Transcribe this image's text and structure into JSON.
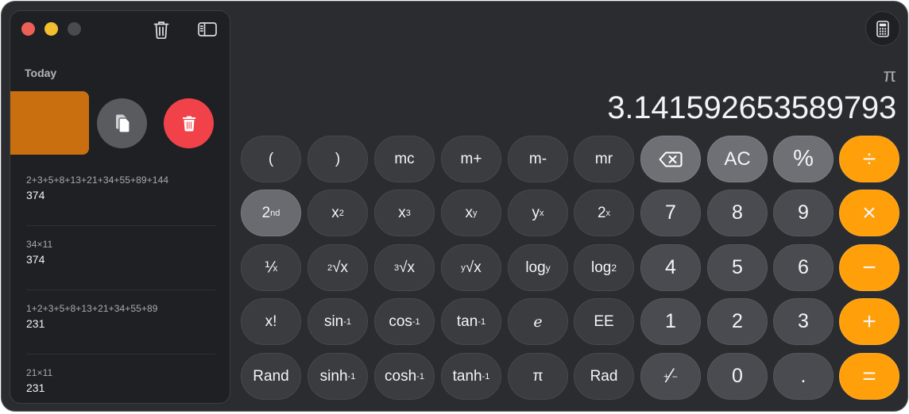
{
  "sidebar": {
    "section_title": "Today",
    "history": [
      {
        "expression": "2+3+5+8+13+21+34+55+89+144",
        "result": "374"
      },
      {
        "expression": "34×11",
        "result": "374"
      },
      {
        "expression": "1+2+3+5+8+13+21+34+55+89",
        "result": "231"
      },
      {
        "expression": "21×11",
        "result": "231"
      }
    ],
    "icons": [
      "trash-icon",
      "sidebar-toggle-icon",
      "copy-icon",
      "delete-icon"
    ]
  },
  "display": {
    "expression": "π",
    "value": "3.141592653589793"
  },
  "keys": {
    "r1": [
      "(",
      ")",
      "mc",
      "m+",
      "m-",
      "mr"
    ],
    "backspace_icon": "backspace-icon",
    "ac": "AC",
    "percent": "%",
    "divide": "÷",
    "second": {
      "base": "2",
      "sup": "nd"
    },
    "x2": {
      "base": "x",
      "sup": "2"
    },
    "x3": {
      "base": "x",
      "sup": "3"
    },
    "xy": {
      "base": "x",
      "sup": "y"
    },
    "yx": {
      "base": "y",
      "sup": "x"
    },
    "twox": {
      "base": "2",
      "sup": "x"
    },
    "d7": "7",
    "d8": "8",
    "d9": "9",
    "multiply": "×",
    "reciprocal": "⅟",
    "reciprocal_sub": "x",
    "sqrt2": {
      "sup": "2",
      "base": "√x"
    },
    "sqrt3": {
      "sup": "3",
      "base": "√x"
    },
    "sqrty": {
      "sup": "y",
      "base": "√x"
    },
    "logy": {
      "base": "log",
      "sub": "y"
    },
    "log2": {
      "base": "log",
      "sub": "2"
    },
    "d4": "4",
    "d5": "5",
    "d6": "6",
    "minus": "−",
    "fact": "x!",
    "sin_inv": {
      "base": "sin",
      "sup": "-1"
    },
    "cos_inv": {
      "base": "cos",
      "sup": "-1"
    },
    "tan_inv": {
      "base": "tan",
      "sup": "-1"
    },
    "e": "e",
    "ee": "EE",
    "d1": "1",
    "d2": "2",
    "d3": "3",
    "plus": "+",
    "rand": "Rand",
    "sinh_inv": {
      "base": "sinh",
      "sup": "-1"
    },
    "cosh_inv": {
      "base": "cosh",
      "sup": "-1"
    },
    "tanh_inv": {
      "base": "tanh",
      "sup": "-1"
    },
    "pi": "π",
    "rad": "Rad",
    "plusminus": {
      "sup": "+",
      "mid": "⁄",
      "sub": "−"
    },
    "d0": "0",
    "decimal": ".",
    "equals": "="
  },
  "colors": {
    "accent": "#ff9f0a",
    "window_bg": "#2a2c30",
    "sidebar_bg": "#1f2023",
    "swiped_row": "#c96f0f",
    "delete": "#f1424a"
  }
}
